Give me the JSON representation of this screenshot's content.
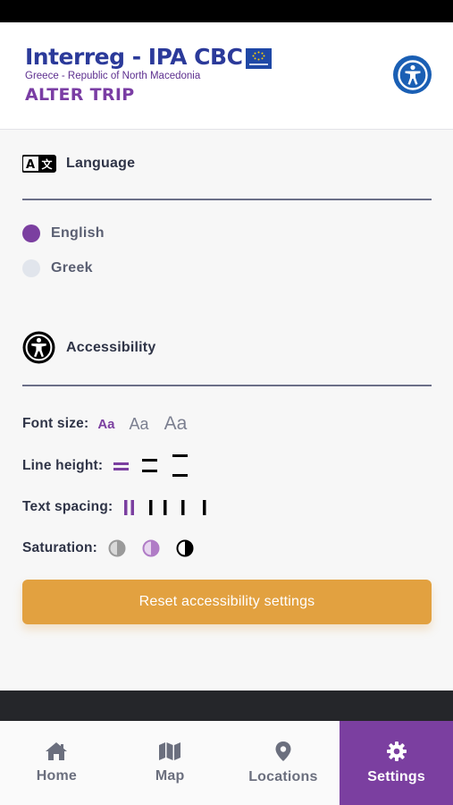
{
  "header": {
    "logo_main": "Interreg - IPA CBC",
    "logo_sub": "Greece - Republic of North Macedonia",
    "app_name": "ALTER TRIP",
    "accessibility_icon": "accessibility-icon"
  },
  "language": {
    "title": "Language",
    "icon": "translate-icon",
    "options": [
      {
        "label": "English",
        "selected": true
      },
      {
        "label": "Greek",
        "selected": false
      }
    ]
  },
  "accessibility": {
    "title": "Accessibility",
    "icon": "accessibility-icon",
    "font_size": {
      "label": "Font size:",
      "options": [
        "Aa",
        "Aa",
        "Aa"
      ],
      "selected_index": 0
    },
    "line_height": {
      "label": "Line height:",
      "selected_index": 0
    },
    "text_spacing": {
      "label": "Text spacing:",
      "selected_index": 0
    },
    "saturation": {
      "label": "Saturation:",
      "selected_index": 1
    },
    "reset_label": "Reset accessibility settings"
  },
  "tabbar": {
    "tabs": [
      {
        "label": "Home",
        "icon": "home-icon",
        "active": false
      },
      {
        "label": "Map",
        "icon": "map-icon",
        "active": false
      },
      {
        "label": "Locations",
        "icon": "location-pin-icon",
        "active": false
      },
      {
        "label": "Settings",
        "icon": "gear-icon",
        "active": true
      }
    ]
  },
  "colors": {
    "accent_purple": "#7b3fa0",
    "reset_orange": "#e2a140",
    "access_blue": "#1a5fb4",
    "text_dark": "#2f3447"
  }
}
